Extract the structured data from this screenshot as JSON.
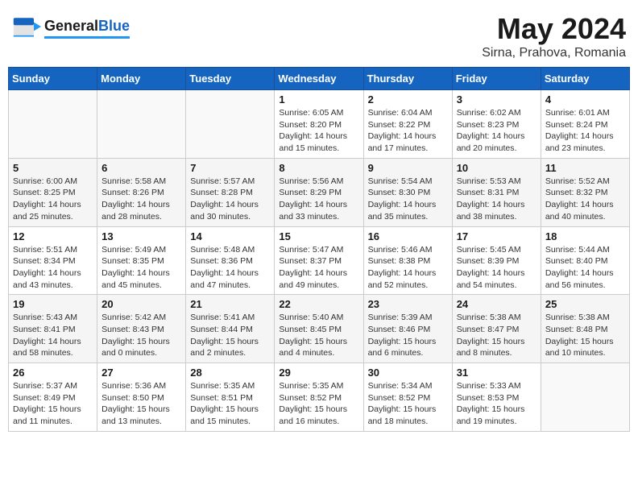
{
  "header": {
    "logo_text_general": "General",
    "logo_text_blue": "Blue",
    "title": "May 2024",
    "subtitle": "Sirna, Prahova, Romania"
  },
  "weekdays": [
    "Sunday",
    "Monday",
    "Tuesday",
    "Wednesday",
    "Thursday",
    "Friday",
    "Saturday"
  ],
  "weeks": [
    [
      {
        "day": "",
        "info": ""
      },
      {
        "day": "",
        "info": ""
      },
      {
        "day": "",
        "info": ""
      },
      {
        "day": "1",
        "info": "Sunrise: 6:05 AM\nSunset: 8:20 PM\nDaylight: 14 hours\nand 15 minutes."
      },
      {
        "day": "2",
        "info": "Sunrise: 6:04 AM\nSunset: 8:22 PM\nDaylight: 14 hours\nand 17 minutes."
      },
      {
        "day": "3",
        "info": "Sunrise: 6:02 AM\nSunset: 8:23 PM\nDaylight: 14 hours\nand 20 minutes."
      },
      {
        "day": "4",
        "info": "Sunrise: 6:01 AM\nSunset: 8:24 PM\nDaylight: 14 hours\nand 23 minutes."
      }
    ],
    [
      {
        "day": "5",
        "info": "Sunrise: 6:00 AM\nSunset: 8:25 PM\nDaylight: 14 hours\nand 25 minutes."
      },
      {
        "day": "6",
        "info": "Sunrise: 5:58 AM\nSunset: 8:26 PM\nDaylight: 14 hours\nand 28 minutes."
      },
      {
        "day": "7",
        "info": "Sunrise: 5:57 AM\nSunset: 8:28 PM\nDaylight: 14 hours\nand 30 minutes."
      },
      {
        "day": "8",
        "info": "Sunrise: 5:56 AM\nSunset: 8:29 PM\nDaylight: 14 hours\nand 33 minutes."
      },
      {
        "day": "9",
        "info": "Sunrise: 5:54 AM\nSunset: 8:30 PM\nDaylight: 14 hours\nand 35 minutes."
      },
      {
        "day": "10",
        "info": "Sunrise: 5:53 AM\nSunset: 8:31 PM\nDaylight: 14 hours\nand 38 minutes."
      },
      {
        "day": "11",
        "info": "Sunrise: 5:52 AM\nSunset: 8:32 PM\nDaylight: 14 hours\nand 40 minutes."
      }
    ],
    [
      {
        "day": "12",
        "info": "Sunrise: 5:51 AM\nSunset: 8:34 PM\nDaylight: 14 hours\nand 43 minutes."
      },
      {
        "day": "13",
        "info": "Sunrise: 5:49 AM\nSunset: 8:35 PM\nDaylight: 14 hours\nand 45 minutes."
      },
      {
        "day": "14",
        "info": "Sunrise: 5:48 AM\nSunset: 8:36 PM\nDaylight: 14 hours\nand 47 minutes."
      },
      {
        "day": "15",
        "info": "Sunrise: 5:47 AM\nSunset: 8:37 PM\nDaylight: 14 hours\nand 49 minutes."
      },
      {
        "day": "16",
        "info": "Sunrise: 5:46 AM\nSunset: 8:38 PM\nDaylight: 14 hours\nand 52 minutes."
      },
      {
        "day": "17",
        "info": "Sunrise: 5:45 AM\nSunset: 8:39 PM\nDaylight: 14 hours\nand 54 minutes."
      },
      {
        "day": "18",
        "info": "Sunrise: 5:44 AM\nSunset: 8:40 PM\nDaylight: 14 hours\nand 56 minutes."
      }
    ],
    [
      {
        "day": "19",
        "info": "Sunrise: 5:43 AM\nSunset: 8:41 PM\nDaylight: 14 hours\nand 58 minutes."
      },
      {
        "day": "20",
        "info": "Sunrise: 5:42 AM\nSunset: 8:43 PM\nDaylight: 15 hours\nand 0 minutes."
      },
      {
        "day": "21",
        "info": "Sunrise: 5:41 AM\nSunset: 8:44 PM\nDaylight: 15 hours\nand 2 minutes."
      },
      {
        "day": "22",
        "info": "Sunrise: 5:40 AM\nSunset: 8:45 PM\nDaylight: 15 hours\nand 4 minutes."
      },
      {
        "day": "23",
        "info": "Sunrise: 5:39 AM\nSunset: 8:46 PM\nDaylight: 15 hours\nand 6 minutes."
      },
      {
        "day": "24",
        "info": "Sunrise: 5:38 AM\nSunset: 8:47 PM\nDaylight: 15 hours\nand 8 minutes."
      },
      {
        "day": "25",
        "info": "Sunrise: 5:38 AM\nSunset: 8:48 PM\nDaylight: 15 hours\nand 10 minutes."
      }
    ],
    [
      {
        "day": "26",
        "info": "Sunrise: 5:37 AM\nSunset: 8:49 PM\nDaylight: 15 hours\nand 11 minutes."
      },
      {
        "day": "27",
        "info": "Sunrise: 5:36 AM\nSunset: 8:50 PM\nDaylight: 15 hours\nand 13 minutes."
      },
      {
        "day": "28",
        "info": "Sunrise: 5:35 AM\nSunset: 8:51 PM\nDaylight: 15 hours\nand 15 minutes."
      },
      {
        "day": "29",
        "info": "Sunrise: 5:35 AM\nSunset: 8:52 PM\nDaylight: 15 hours\nand 16 minutes."
      },
      {
        "day": "30",
        "info": "Sunrise: 5:34 AM\nSunset: 8:52 PM\nDaylight: 15 hours\nand 18 minutes."
      },
      {
        "day": "31",
        "info": "Sunrise: 5:33 AM\nSunset: 8:53 PM\nDaylight: 15 hours\nand 19 minutes."
      },
      {
        "day": "",
        "info": ""
      }
    ]
  ]
}
